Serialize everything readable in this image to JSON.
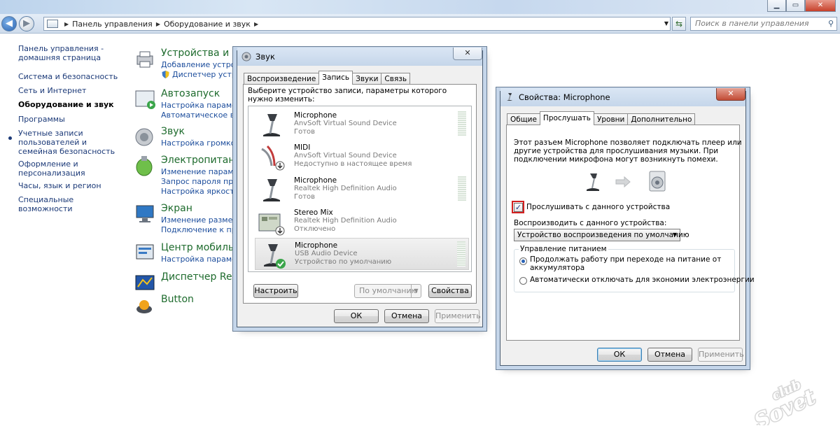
{
  "explorer": {
    "breadcrumb": [
      "Панель управления",
      "Оборудование и звук"
    ],
    "search_placeholder": "Поиск в панели управления"
  },
  "leftpane": {
    "items": [
      "Панель управления - домашняя страница",
      "Система и безопасность",
      "Сеть и Интернет",
      "Оборудование и звук",
      "Программы",
      "Учетные записи пользователей и семейная безопасность",
      "Оформление и персонализация",
      "Часы, язык и регион",
      "Специальные возможности"
    ]
  },
  "categories": [
    {
      "title": "Устройства и пр",
      "links": [
        "Добавление устройс",
        "Диспетчер устрой"
      ]
    },
    {
      "title": "Автозапуск",
      "links": [
        "Настройка параметр",
        "Автоматическое восп"
      ]
    },
    {
      "title": "Звук",
      "links": [
        "Настройка громкост"
      ]
    },
    {
      "title": "Электропитание",
      "links": [
        "Изменение параметр",
        "Запрос пароля при",
        "Настройка яркости э"
      ]
    },
    {
      "title": "Экран",
      "links": [
        "Изменение размеров",
        "Подключение к прое"
      ]
    },
    {
      "title": "Центр мобильно",
      "links": [
        "Настройка параметр"
      ]
    },
    {
      "title": "Диспетчер Realte",
      "links": []
    },
    {
      "title": "Button",
      "links": []
    }
  ],
  "sound_dialog": {
    "title": "Звук",
    "tabs": [
      "Воспроизведение",
      "Запись",
      "Звуки",
      "Связь"
    ],
    "instruction": "Выберите устройство записи, параметры которого нужно изменить:",
    "devices": [
      {
        "name": "Microphone",
        "driver": "AnvSoft Virtual Sound Device",
        "status": "Готов"
      },
      {
        "name": "MIDI",
        "driver": "AnvSoft Virtual Sound Device",
        "status": "Недоступно в настоящее время"
      },
      {
        "name": "Microphone",
        "driver": "Realtek High Definition Audio",
        "status": "Готов"
      },
      {
        "name": "Stereo Mix",
        "driver": "Realtek High Definition Audio",
        "status": "Отключено"
      },
      {
        "name": "Microphone",
        "driver": "USB Audio Device",
        "status": "Устройство по умолчанию"
      }
    ],
    "configure": "Настроить",
    "default_btn": "По умолчанию",
    "properties": "Свойства",
    "ok": "ОК",
    "cancel": "Отмена",
    "apply": "Применить"
  },
  "mic_dialog": {
    "title": "Свойства: Microphone",
    "tabs": [
      "Общие",
      "Прослушать",
      "Уровни",
      "Дополнительно"
    ],
    "description": [
      "Этот разъем Microphone позволяет подключать плеер или",
      "другие устройства для прослушивания музыки. При",
      "подключении микрофона могут возникнуть помехи."
    ],
    "listen_checkbox": "Прослушивать с данного устройства",
    "listen_checked": true,
    "playback_label": "Воспроизводить с данного устройства:",
    "playback_value": "Устройство воспроизведения по умолчанию",
    "power_group": "Управление питанием",
    "power_opt1": [
      "Продолжать работу при переходе на питание от",
      "аккумулятора"
    ],
    "power_opt2": "Автоматически отключать для экономии электроэнергии",
    "ok": "ОК",
    "cancel": "Отмена",
    "apply": "Применить"
  },
  "watermark": {
    "line1": "club",
    "line2": "Sovet"
  }
}
